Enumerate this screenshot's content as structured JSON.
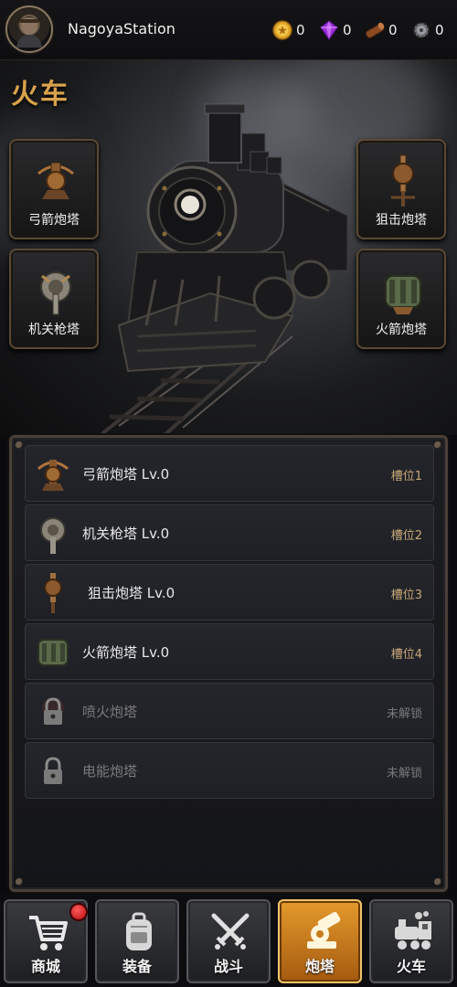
{
  "header": {
    "username": "NagoyaStation",
    "resources": [
      {
        "icon": "gold-coin-icon",
        "value": "0"
      },
      {
        "icon": "purple-gem-icon",
        "value": "0"
      },
      {
        "icon": "wood-log-icon",
        "value": "0"
      },
      {
        "icon": "gear-ore-icon",
        "value": "0"
      }
    ]
  },
  "page": {
    "title": "火车"
  },
  "slots": [
    {
      "label": "弓箭炮塔"
    },
    {
      "label": "狙击炮塔"
    },
    {
      "label": "机关枪塔"
    },
    {
      "label": "火箭炮塔"
    }
  ],
  "turret_list": [
    {
      "name": "弓箭炮塔  Lv.0",
      "status": "槽位1",
      "locked": false,
      "icon": "crossbow-turret-icon"
    },
    {
      "name": "机关枪塔  Lv.0",
      "status": "槽位2",
      "locked": false,
      "icon": "machinegun-turret-icon"
    },
    {
      "name": "狙击炮塔  Lv.0",
      "status": "槽位3",
      "locked": false,
      "icon": "sniper-turret-icon"
    },
    {
      "name": "火箭炮塔  Lv.0",
      "status": "槽位4",
      "locked": false,
      "icon": "rocket-turret-icon"
    },
    {
      "name": "喷火炮塔",
      "status": "未解锁",
      "locked": true,
      "icon": "locked-flamethrower-icon"
    },
    {
      "name": "电能炮塔",
      "status": "未解锁",
      "locked": true,
      "icon": "locked-electric-icon"
    }
  ],
  "nav": [
    {
      "label": "商城",
      "icon": "shopping-cart-icon",
      "active": false,
      "badge": true
    },
    {
      "label": "装备",
      "icon": "backpack-icon",
      "active": false,
      "badge": false
    },
    {
      "label": "战斗",
      "icon": "crossed-swords-icon",
      "active": false,
      "badge": false
    },
    {
      "label": "炮塔",
      "icon": "cannon-icon",
      "active": true,
      "badge": false
    },
    {
      "label": "火车",
      "icon": "train-icon",
      "active": false,
      "badge": false
    }
  ],
  "colors": {
    "accent": "#d8a24c",
    "active_nav": "#e49a2c",
    "badge": "#d01a1a",
    "slot_text": "#c9a878"
  }
}
